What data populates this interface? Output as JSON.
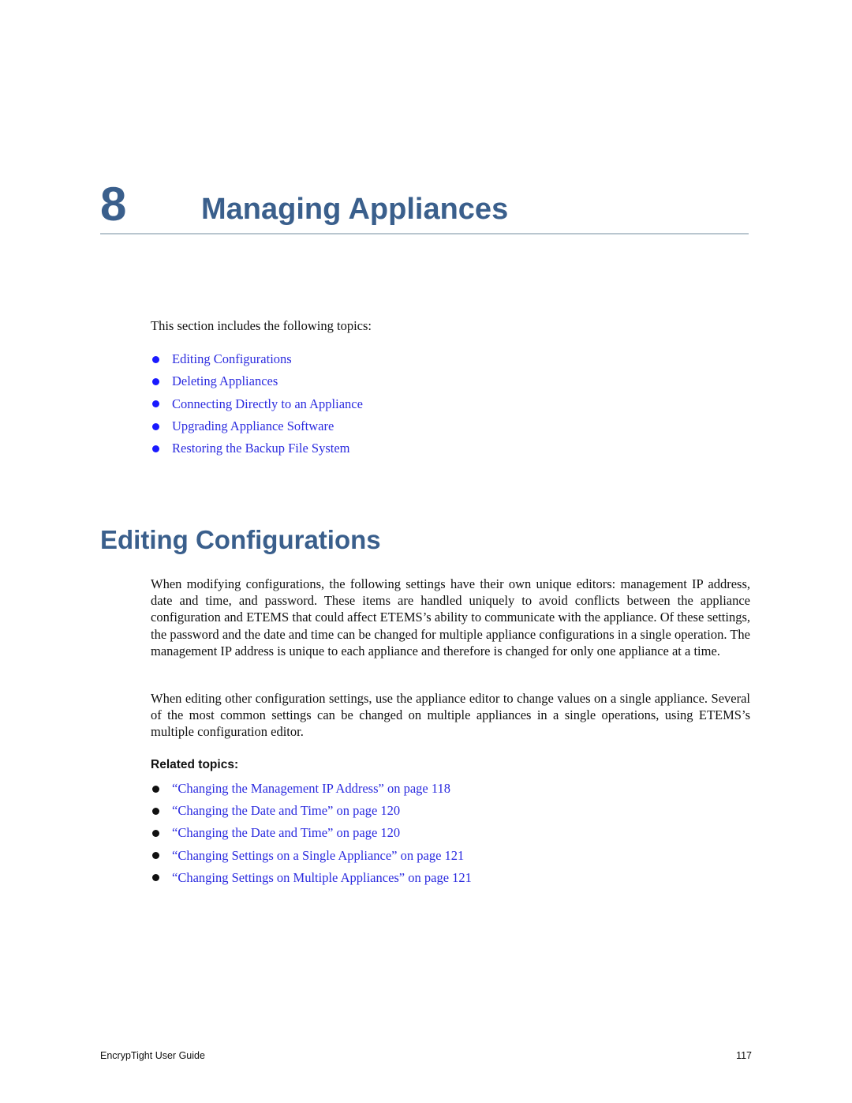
{
  "chapter": {
    "number": "8",
    "title": "Managing Appliances"
  },
  "intro": {
    "text": "This section includes the following topics:",
    "topics": [
      {
        "label": "Editing Configurations"
      },
      {
        "label": "Deleting Appliances"
      },
      {
        "label": "Connecting Directly to an Appliance"
      },
      {
        "label": "Upgrading Appliance Software"
      },
      {
        "label": "Restoring the Backup File System"
      }
    ]
  },
  "section": {
    "title": "Editing Configurations",
    "paragraphs": [
      "When modifying configurations, the following settings have their own unique editors: management IP address, date and time, and password. These items are handled uniquely to avoid conflicts between the appliance configuration and ETEMS that could affect ETEMS’s ability to communicate with the appliance. Of these settings, the password and the date and time can be changed for multiple appliance configurations in a single operation. The management IP address is unique to each appliance and therefore is changed for only one appliance at a time.",
      "When editing other configuration settings, use the appliance editor to change values on a single appliance. Several of the most common settings can be changed on multiple appliances in a single operations, using ETEMS’s multiple configuration editor."
    ],
    "related_heading": "Related topics:",
    "related": [
      {
        "label": "“Changing the Management IP Address” on page 118"
      },
      {
        "label": "“Changing the Date and Time” on page 120"
      },
      {
        "label": "“Changing the Date and Time” on page 120"
      },
      {
        "label": "“Changing Settings on a Single Appliance” on page 121"
      },
      {
        "label": "“Changing Settings on Multiple Appliances” on page 121"
      }
    ]
  },
  "footer": {
    "guide_title": "EncrypTight User Guide",
    "page_number": "117"
  },
  "colors": {
    "heading": "#3a5f8c",
    "link": "#2b2bdf",
    "rule": "#b9c6cf"
  }
}
